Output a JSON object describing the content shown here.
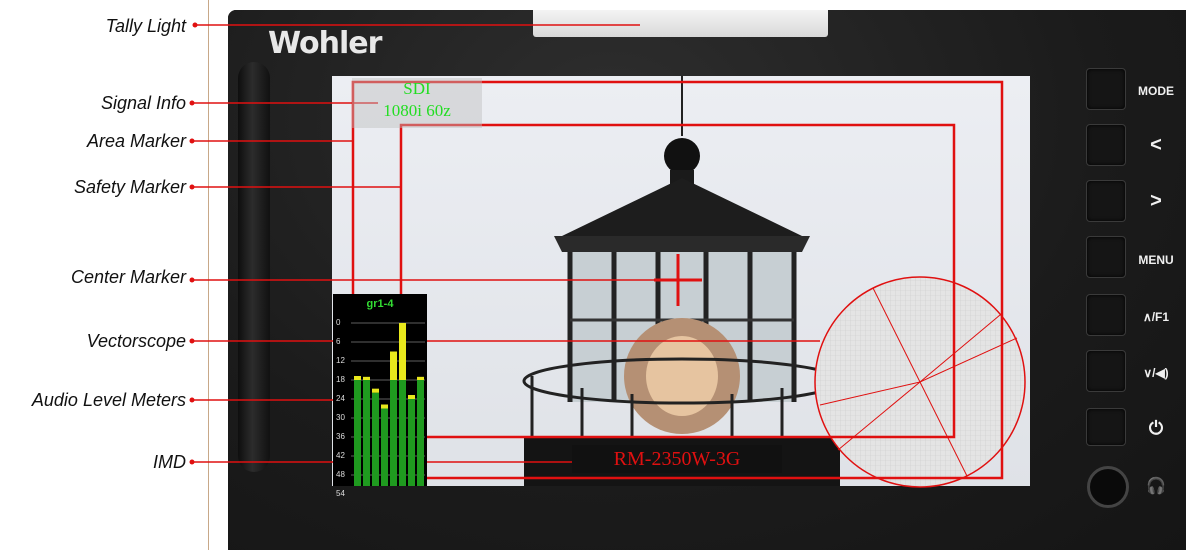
{
  "callouts": [
    {
      "id": "tally",
      "label": "Tally Light"
    },
    {
      "id": "signal",
      "label": "Signal Info"
    },
    {
      "id": "area",
      "label": "Area Marker"
    },
    {
      "id": "safety",
      "label": "Safety Marker"
    },
    {
      "id": "center",
      "label": "Center Marker"
    },
    {
      "id": "vector",
      "label": "Vectorscope"
    },
    {
      "id": "audio",
      "label": "Audio Level Meters"
    },
    {
      "id": "imd",
      "label": "IMD"
    }
  ],
  "brand": "Wohler",
  "signal_info": {
    "line1": "SDI",
    "line2": "1080i 60z"
  },
  "imd_text": "RM-2350W-3G",
  "buttons": [
    {
      "id": "mode",
      "label": "MODE"
    },
    {
      "id": "left",
      "label": "<"
    },
    {
      "id": "right",
      "label": ">"
    },
    {
      "id": "menu",
      "label": "MENU"
    },
    {
      "id": "up",
      "label": "∧/F1"
    },
    {
      "id": "down",
      "label": "∨/◀)"
    },
    {
      "id": "power",
      "label": "⏻"
    },
    {
      "id": "headphones",
      "label": "🎧"
    }
  ],
  "audio_meter": {
    "title": "gr1-4",
    "scale": [
      "0",
      "6",
      "12",
      "18",
      "24",
      "30",
      "36",
      "42",
      "48",
      "54"
    ],
    "levels_db": [
      18,
      17,
      22,
      27,
      9,
      0,
      24,
      17
    ]
  },
  "colors": {
    "marker": "#e01010",
    "signal_text": "#22dd22"
  }
}
